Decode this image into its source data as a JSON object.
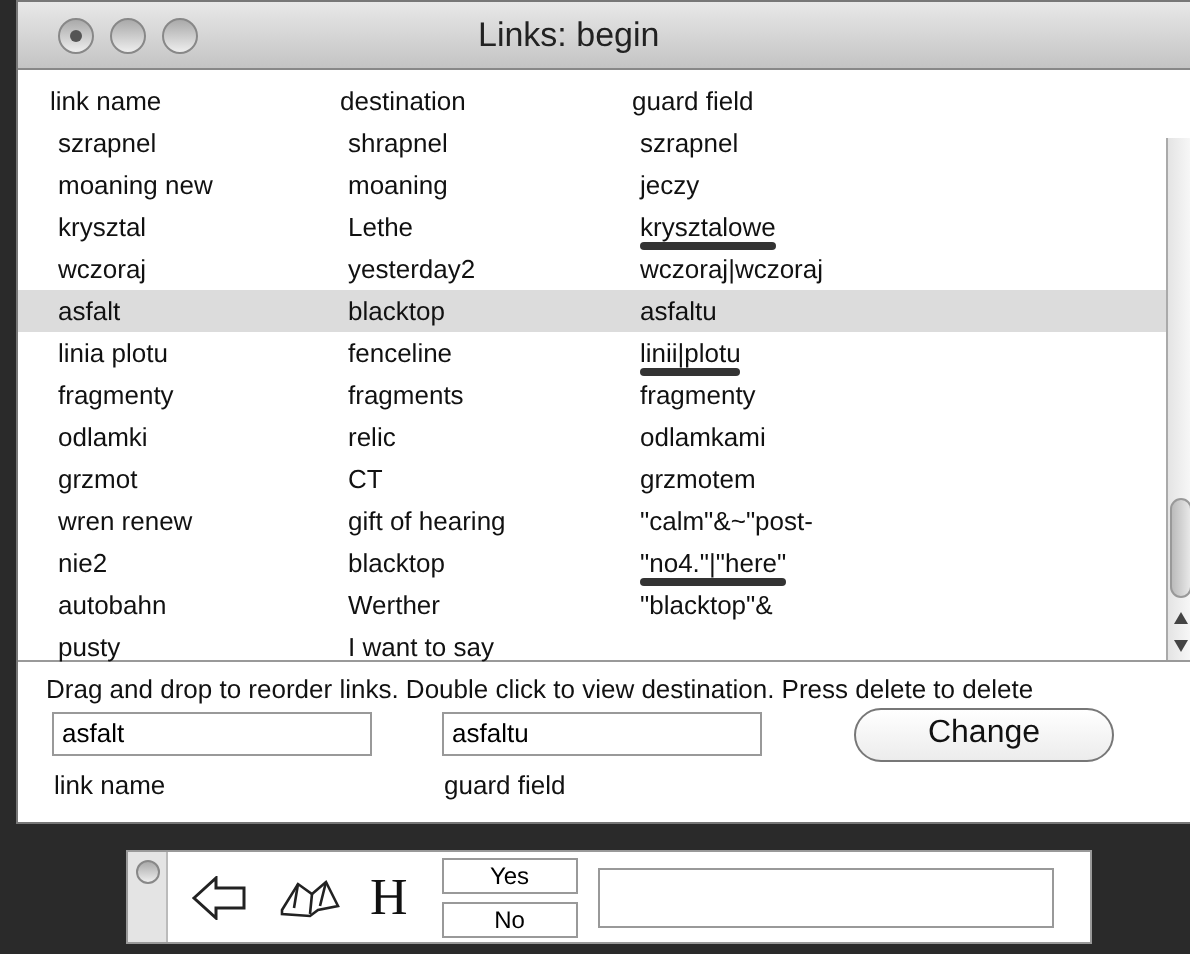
{
  "window": {
    "title": "Links: begin"
  },
  "table": {
    "columns": [
      "link name",
      "destination",
      "guard field"
    ],
    "rows": [
      {
        "link_name": "szrapnel",
        "destination": "shrapnel",
        "guard_field": "szrapnel",
        "selected": false,
        "underlined": false
      },
      {
        "link_name": "moaning new",
        "destination": "moaning",
        "guard_field": "jeczy",
        "selected": false,
        "underlined": false
      },
      {
        "link_name": "krysztal",
        "destination": "Lethe",
        "guard_field": "krysztalowe",
        "selected": false,
        "underlined": true
      },
      {
        "link_name": "wczoraj",
        "destination": "yesterday2",
        "guard_field": "wczoraj|wczoraj",
        "selected": false,
        "underlined": false
      },
      {
        "link_name": "asfalt",
        "destination": "blacktop",
        "guard_field": "asfaltu",
        "selected": true,
        "underlined": false
      },
      {
        "link_name": "linia plotu",
        "destination": "fenceline",
        "guard_field": "linii|plotu",
        "selected": false,
        "underlined": true
      },
      {
        "link_name": "fragmenty",
        "destination": "fragments",
        "guard_field": "fragmenty",
        "selected": false,
        "underlined": false
      },
      {
        "link_name": "odlamki",
        "destination": "relic",
        "guard_field": "odlamkami",
        "selected": false,
        "underlined": false
      },
      {
        "link_name": "grzmot",
        "destination": "CT",
        "guard_field": "grzmotem",
        "selected": false,
        "underlined": false
      },
      {
        "link_name": "wren renew",
        "destination": "gift of hearing",
        "guard_field": "\"calm\"&~\"post-",
        "selected": false,
        "underlined": false
      },
      {
        "link_name": "nie2",
        "destination": "blacktop",
        "guard_field": "\"no4.\"|\"here\"",
        "selected": false,
        "underlined": true
      },
      {
        "link_name": "autobahn",
        "destination": "Werther",
        "guard_field": "\"blacktop\"&",
        "selected": false,
        "underlined": false
      },
      {
        "link_name": "pusty",
        "destination": "I want to say",
        "guard_field": "",
        "selected": false,
        "underlined": false
      }
    ]
  },
  "instructions": "Drag and drop to reorder links. Double click to view destination. Press delete to delete",
  "editor": {
    "link_name": {
      "value": "asfalt",
      "label": "link name"
    },
    "guard_field": {
      "value": "asfaltu",
      "label": "guard field"
    },
    "button": "Change"
  },
  "toolbar": {
    "heading_glyph": "H",
    "yes": "Yes",
    "no": "No"
  }
}
